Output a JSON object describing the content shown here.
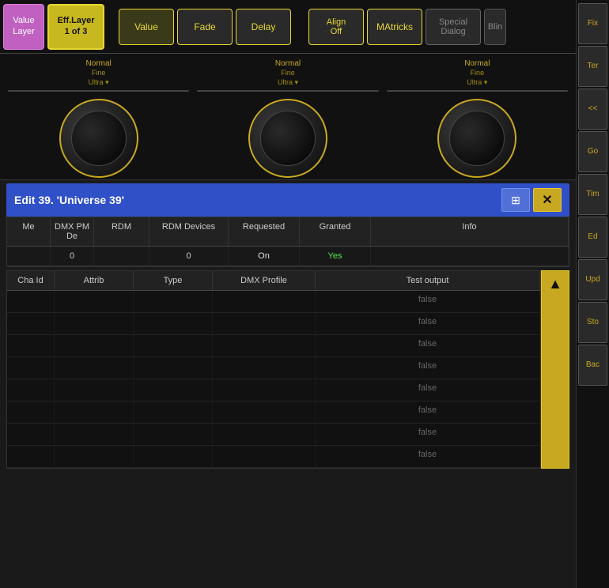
{
  "toolbar": {
    "value_layer_label": "Value\nLayer",
    "eff_layer_label": "Eff.Layer\n1 of 3",
    "value_btn": "Value",
    "fade_btn": "Fade",
    "delay_btn": "Delay",
    "align_off_btn": "Align\nOff",
    "matricks_btn": "MAtricks",
    "special_dialog_btn": "Special\nDialog",
    "blin_btn": "Blin"
  },
  "knobs": [
    {
      "label1": "Normal",
      "label2": "Fine",
      "label3": "Ultra"
    },
    {
      "label1": "Normal",
      "label2": "Fine",
      "label3": "Ultra"
    },
    {
      "label1": "Normal",
      "label2": "Fine",
      "label3": "Ultra"
    }
  ],
  "dialog": {
    "title": "Edit 39. 'Universe 39'",
    "close_label": "✕",
    "camera_icon": "⊞"
  },
  "universe_table": {
    "headers": [
      "Me",
      "DMX PM De",
      "RDM",
      "RDM Devices",
      "Requested",
      "Granted",
      "Info"
    ],
    "rows": [
      {
        "me": "",
        "dmx": "0",
        "rdm": "",
        "rdm_devices": "0",
        "requested": "On",
        "granted": "Yes",
        "info": ""
      }
    ]
  },
  "channel_table": {
    "headers": [
      "Cha Id",
      "Attrib",
      "Type",
      "DMX Profile",
      "Test output"
    ],
    "rows": [
      {
        "cha_id": "",
        "attrib": "",
        "type": "",
        "dmx_profile": "",
        "test_output": "false"
      },
      {
        "cha_id": "",
        "attrib": "",
        "type": "",
        "dmx_profile": "",
        "test_output": "false"
      },
      {
        "cha_id": "",
        "attrib": "",
        "type": "",
        "dmx_profile": "",
        "test_output": "false"
      },
      {
        "cha_id": "",
        "attrib": "",
        "type": "",
        "dmx_profile": "",
        "test_output": "false"
      },
      {
        "cha_id": "",
        "attrib": "",
        "type": "",
        "dmx_profile": "",
        "test_output": "false"
      },
      {
        "cha_id": "",
        "attrib": "",
        "type": "",
        "dmx_profile": "",
        "test_output": "false"
      },
      {
        "cha_id": "",
        "attrib": "",
        "type": "",
        "dmx_profile": "",
        "test_output": "false"
      },
      {
        "cha_id": "",
        "attrib": "",
        "type": "",
        "dmx_profile": "",
        "test_output": "false"
      }
    ]
  },
  "sidebar": {
    "buttons": [
      "Fix",
      "Ter",
      "<<",
      "Go",
      "Tim",
      "Ed",
      "Upd",
      "Sto",
      "Bac"
    ]
  }
}
